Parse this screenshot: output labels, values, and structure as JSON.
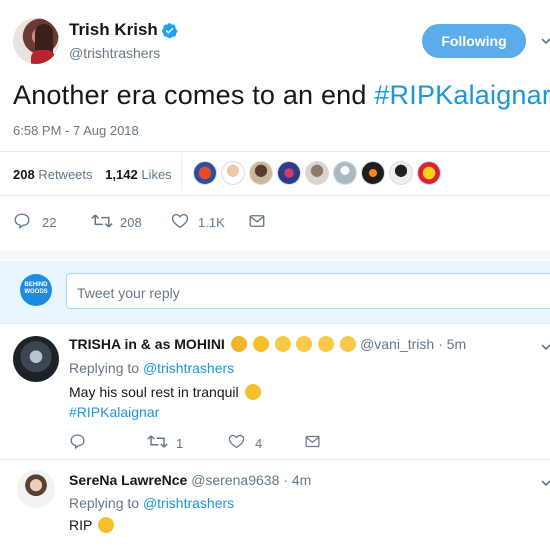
{
  "tweet": {
    "display_name": "Trish Krish",
    "handle": "@trishtrashers",
    "follow_label": "Following",
    "text_plain": "Another era comes to an end ",
    "text_hashtag": "#RIPKalaignar",
    "timestamp": "6:58 PM - 7 Aug 2018",
    "retweet_count": "208",
    "retweet_label": "Retweets",
    "like_count": "1,142",
    "like_label": "Likes",
    "actions": {
      "reply_count": "22",
      "retweet_count": "208",
      "like_count": "1.1K"
    }
  },
  "reply_box": {
    "logo_text": "BEHIND WOODS",
    "placeholder": "Tweet your reply"
  },
  "replies": [
    {
      "name": "TRISHA in & as MOHINI",
      "handle": "@vani_trish",
      "time": "5m",
      "replying_prefix": "Replying to",
      "replying_to": "@trishtrashers",
      "text": "May his soul rest in tranquil",
      "hashtag": "#RIPKalaignar",
      "reply_count": "",
      "retweet_count": "1",
      "like_count": "4"
    },
    {
      "name": "SereNa LawreNce",
      "handle": "@serena9638",
      "time": "4m",
      "replying_prefix": "Replying to",
      "replying_to": "@trishtrashers",
      "text": "RIP"
    }
  ],
  "colors": {
    "accent": "#1b95e0",
    "follow_button": "#5aadea",
    "muted": "#657786"
  },
  "icons": [
    "verified-badge-icon",
    "chevron-down-icon",
    "reply-icon",
    "retweet-icon",
    "like-icon",
    "direct-message-icon"
  ]
}
